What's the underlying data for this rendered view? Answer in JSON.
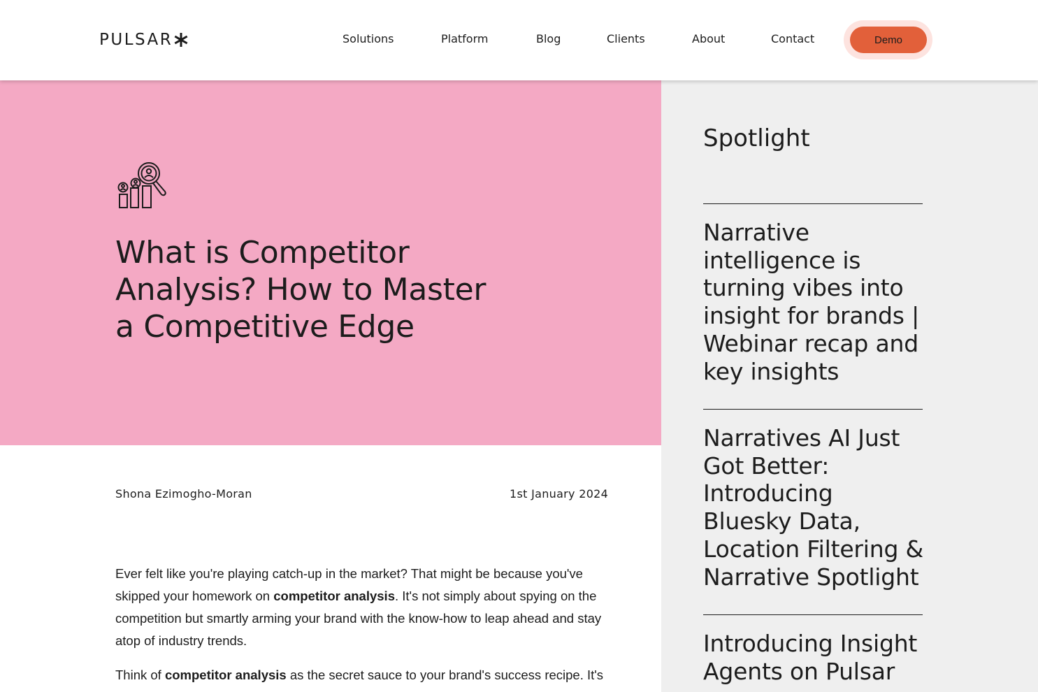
{
  "header": {
    "logo": "PULSAR",
    "nav": [
      "Solutions",
      "Platform",
      "Blog",
      "Clients",
      "About",
      "Contact"
    ],
    "demo_label": "Demo"
  },
  "hero": {
    "icon": "competitor-analysis-icon",
    "title": "What is Competitor Analysis? How to Master a Competitive Edge",
    "background": "#f4a9c4"
  },
  "meta": {
    "author": "Shona Ezimogho-Moran",
    "date": "1st January 2024"
  },
  "article": {
    "p1_a": "Ever felt like you're playing catch-up in the market? That might be because you've skipped your homework on ",
    "p1_b": "competitor analysis",
    "p1_c": ". It's not simply about spying on the competition but smartly arming your brand with the know-how to leap ahead and stay atop of industry trends.",
    "p2_a": "Think of ",
    "p2_b": "competitor analysis",
    "p2_c": " as the secret sauce to your brand's success recipe. It's"
  },
  "sidebar": {
    "heading": "Spotlight",
    "posts": [
      "Narrative intelligence is turning vibes into insight for brands | Webinar recap and key insights",
      "Narratives AI Just Got Better: Introducing Bluesky Data, Location Filtering & Narrative Spotlight",
      "Introducing Insight Agents on Pulsar"
    ]
  },
  "colors": {
    "accent": "#e2603a",
    "hero_pink": "#f4a9c4",
    "sidebar_bg": "#efefef",
    "text": "#1c1c1c"
  }
}
